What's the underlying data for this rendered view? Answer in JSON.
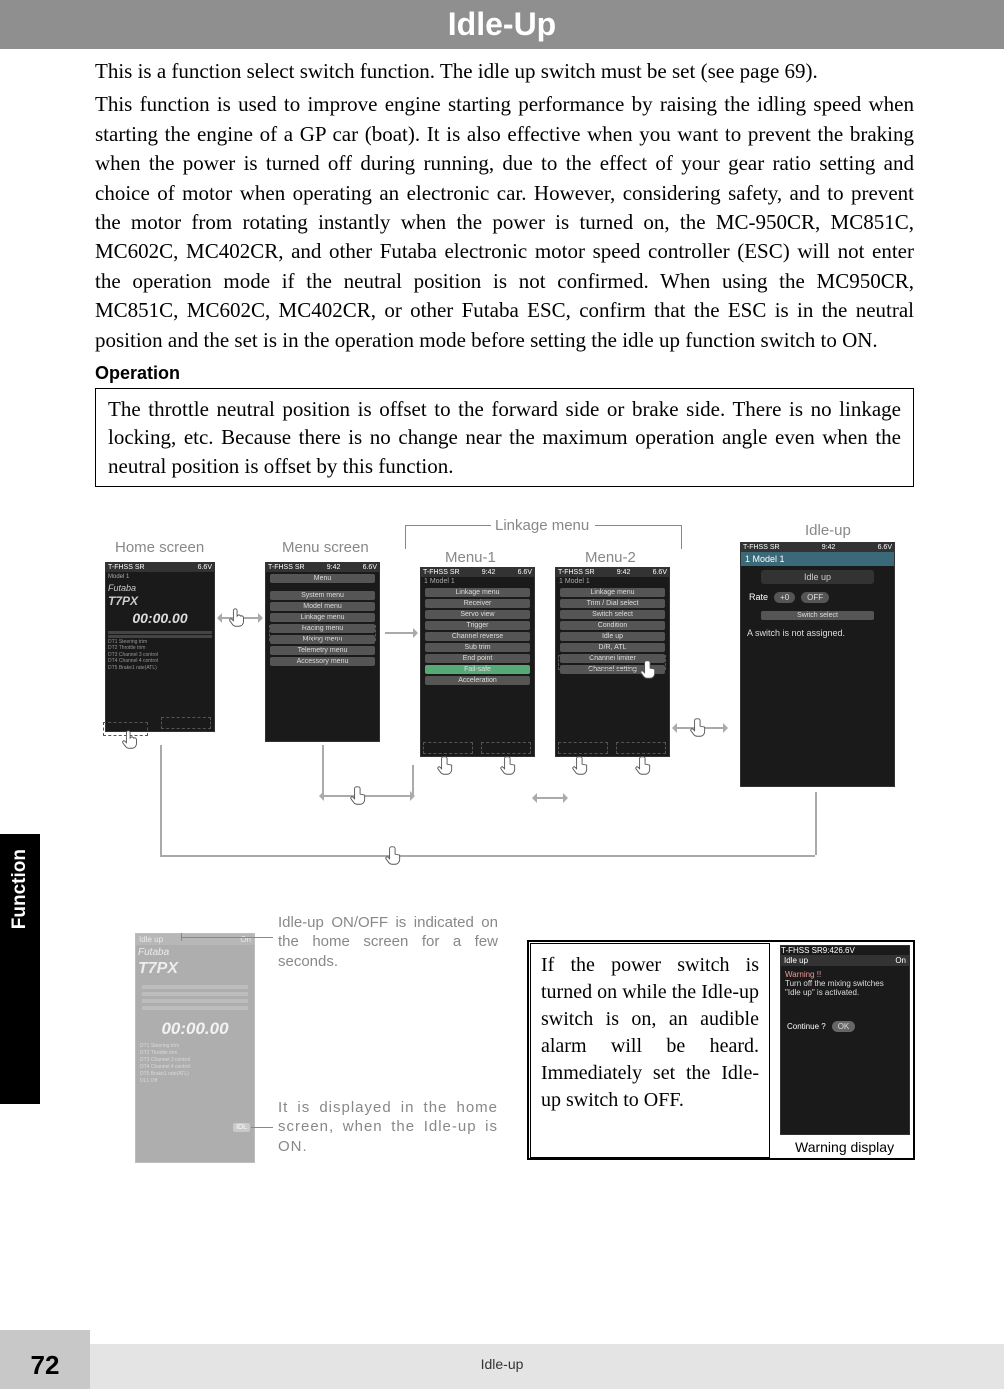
{
  "header": {
    "title": "Idle-Up"
  },
  "intro": {
    "p1": "This is a function select switch function. The idle up switch must be set (see page 69).",
    "p2": "This function is used to improve engine starting performance by raising the idling speed when starting the engine of a GP car (boat). It is also effective when you want to prevent the braking when the power is turned off during running, due to the effect of your gear ratio setting and choice of motor when operating an electronic car. However, considering safety, and to prevent the motor from rotating instantly when the power is turned on, the MC-950CR, MC851C, MC602C, MC402CR, and other Futaba electronic motor speed controller (ESC) will not enter the operation mode if the neutral position is not confirmed. When using the MC950CR, MC851C, MC602C, MC402CR, or other Futaba ESC, confirm that the ESC is in the neutral position and the set is in the operation mode before setting the idle up function switch to ON."
  },
  "operation": {
    "heading": "Operation",
    "body": "The throttle neutral position is offset to the forward side or brake side. There is no linkage locking, etc. Because there is no change near the maximum operation angle even when the neutral position is offset by this function."
  },
  "diagram": {
    "home_label": "Home screen",
    "menu_label": "Menu screen",
    "linkage_label": "Linkage menu",
    "menu1_label": "Menu-1",
    "menu2_label": "Menu-2",
    "idleup_label": "Idle-up",
    "home": {
      "bar": "T-FHSS SR",
      "timer": "00:00.00"
    },
    "menu_items": [
      "Menu",
      "System menu",
      "Model menu",
      "Linkage menu",
      "Racing menu",
      "Mixing menu",
      "Telemetry menu",
      "Accessory menu"
    ],
    "menu1_items": [
      "Linkage menu",
      "Receiver",
      "Servo view",
      "Trigger",
      "Channel reverse",
      "Sub trim",
      "End point",
      "Fail-safe",
      "Acceleration"
    ],
    "menu2_items": [
      "Linkage menu",
      "Trim / Dial select",
      "Switch select",
      "Condition",
      "Idle up",
      "D/R, ATL",
      "Channel limiter",
      "Channel setting"
    ],
    "idleup": {
      "bar_l": "T-FHSS SR",
      "bar_c": "9:42",
      "bar_r": "6.6V",
      "model": "1   Model 1",
      "title": "Idle up",
      "rate": "Rate",
      "rate_val": "+0",
      "rate_off": "OFF",
      "switch_sel": "Switch select",
      "msg": "A switch is not assigned."
    }
  },
  "lower": {
    "note1": "Idle-up ON/OFF is indicated on the home screen for a few seconds.",
    "note2": "It is displayed in the home screen, when the Idle-up is ON.",
    "idle_label": "Idle up",
    "idle_state": "On",
    "timer": "00:00.00",
    "idl_badge": "IDL",
    "power_box": "If the power switch is turned on while the Idle-up switch is on, an audible alarm will be heard. Immediately set the Idle-up switch to OFF.",
    "warn": {
      "bar_l": "T-FHSS SR",
      "bar_c": "9:42",
      "bar_r": "6.6V",
      "idle": "Idle up",
      "idle_state": "On",
      "w1": "Warning !!",
      "w2": "Turn off the mixing switches",
      "w3": "\"Idle up\" is activated.",
      "cont": "Continue ?",
      "ok": "OK"
    },
    "warn_label": "Warning display"
  },
  "side_tab": "Function",
  "footer": {
    "page": "72",
    "title": "Idle-up"
  }
}
